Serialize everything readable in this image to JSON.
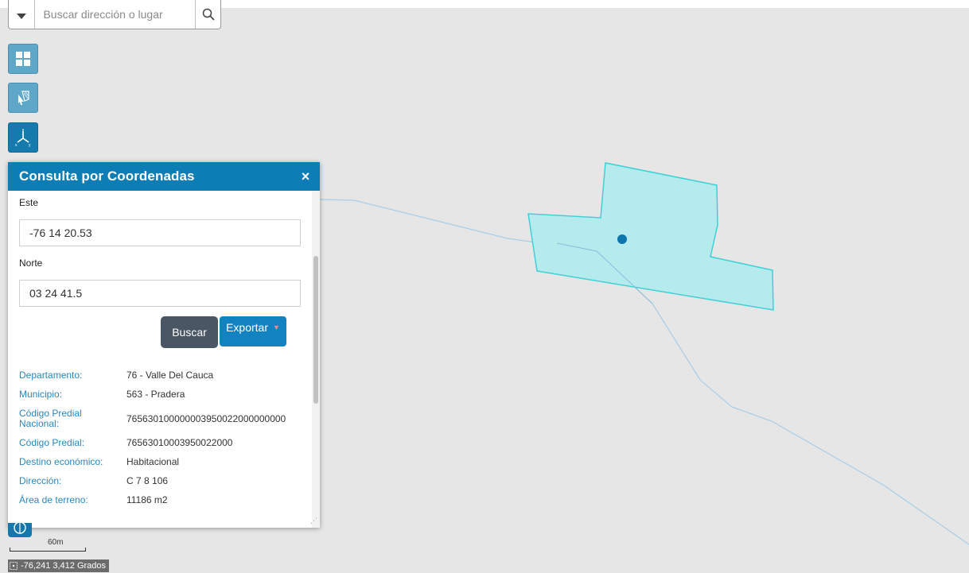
{
  "search": {
    "placeholder": "Buscar dirección o lugar"
  },
  "panel": {
    "title": "Consulta por Coordenadas",
    "close_label": "×",
    "este_label": "Este",
    "este_value": "-76 14 20.53",
    "norte_label": "Norte",
    "norte_value": "03 24 41.5",
    "buscar_label": "Buscar",
    "exportar_label": "Exportar",
    "info": [
      {
        "key": "Departamento:",
        "value": "76 - Valle Del Cauca"
      },
      {
        "key": "Municipio:",
        "value": "563 - Pradera"
      },
      {
        "key": "Código Predial Nacional:",
        "value": "765630100000003950022000000000"
      },
      {
        "key": "Código Predial:",
        "value": "76563010003950022000"
      },
      {
        "key": "Destino económico:",
        "value": "Habitacional"
      },
      {
        "key": "Dirección:",
        "value": "C 7 8 106"
      },
      {
        "key": "Área de terreno:",
        "value": "11186 m2"
      }
    ]
  },
  "scale": {
    "label": "60m"
  },
  "coords": {
    "text": "-76,241 3,412 Grados"
  },
  "colors": {
    "accent": "#0d7db6",
    "parcel_fill": "#b2ecee",
    "parcel_stroke": "#3fd0d6",
    "road": "#a8cde8"
  },
  "icons": [
    "chevron-down-icon",
    "search-icon",
    "grid-icon",
    "select-tool-icon",
    "xyz-axis-icon",
    "close-icon",
    "locate-icon",
    "crosshair-icon"
  ]
}
